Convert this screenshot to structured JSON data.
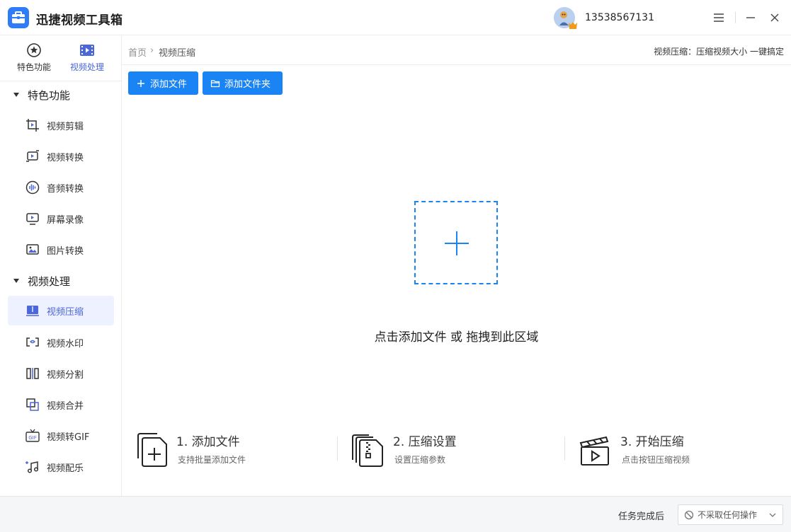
{
  "app": {
    "title": "迅捷视频工具箱",
    "accent": "#1a84f4",
    "nav_active_color": "#4b67d8"
  },
  "user": {
    "phone": "13538567131",
    "avatar_icon": "avatar-icon",
    "badge_icon": "vip-badge-icon"
  },
  "window_controls": [
    "menu-icon",
    "minimize-icon",
    "close-icon"
  ],
  "sidebar": {
    "tabs": [
      {
        "label": "特色功能",
        "icon": "star-circle-icon",
        "active": false
      },
      {
        "label": "视频处理",
        "icon": "film-icon",
        "active": true
      }
    ],
    "groups": [
      {
        "label": "特色功能",
        "items": [
          {
            "label": "视频剪辑",
            "icon": "video-crop-icon"
          },
          {
            "label": "视频转换",
            "icon": "video-convert-icon"
          },
          {
            "label": "音频转换",
            "icon": "audio-wave-icon"
          },
          {
            "label": "屏幕录像",
            "icon": "screen-record-icon"
          },
          {
            "label": "图片转换",
            "icon": "image-convert-icon"
          }
        ]
      },
      {
        "label": "视频处理",
        "items": [
          {
            "label": "视频压缩",
            "icon": "video-compress-icon",
            "active": true
          },
          {
            "label": "视频水印",
            "icon": "watermark-icon"
          },
          {
            "label": "视频分割",
            "icon": "split-icon"
          },
          {
            "label": "视频合并",
            "icon": "merge-icon"
          },
          {
            "label": "视频转GIF",
            "icon": "gif-icon"
          },
          {
            "label": "视频配乐",
            "icon": "music-icon"
          }
        ]
      }
    ]
  },
  "breadcrumb": {
    "home": "首页",
    "separator": "›",
    "current": "视频压缩"
  },
  "hint": "视频压缩：压缩视频大小 一键搞定",
  "toolbar": {
    "add_file": "添加文件",
    "add_folder": "添加文件夹"
  },
  "dropzone": {
    "text": "点击添加文件 或 拖拽到此区域"
  },
  "steps": [
    {
      "title": "1. 添加文件",
      "desc": "支持批量添加文件",
      "icon": "add-file-icon"
    },
    {
      "title": "2. 压缩设置",
      "desc": "设置压缩参数",
      "icon": "compress-file-icon"
    },
    {
      "title": "3. 开始压缩",
      "desc": "点击按钮压缩视频",
      "icon": "clapper-play-icon"
    }
  ],
  "footer": {
    "label": "任务完成后",
    "select_value": "不采取任何操作"
  }
}
